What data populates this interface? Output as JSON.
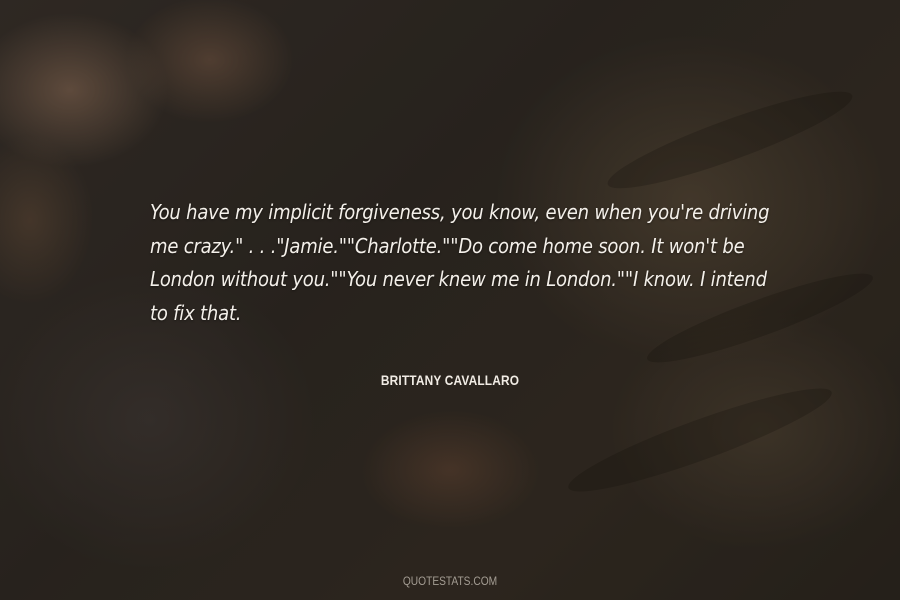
{
  "quote": {
    "text": "You have my implicit forgiveness, you know, even when you're driving me crazy.\" . . .\"Jamie.\"\"Charlotte.\"\"Do come home soon. It won't be London without you.\"\"You never knew me in London.\"\"I know. I intend to fix that."
  },
  "author": {
    "name": "BRITTANY CAVALLARO"
  },
  "watermark": {
    "text": "QUOTESTATS.COM"
  }
}
